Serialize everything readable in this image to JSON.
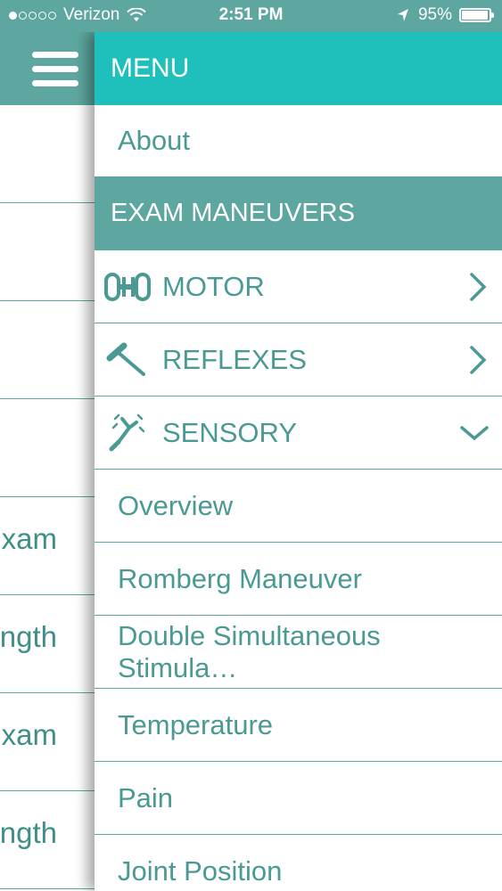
{
  "status_bar": {
    "carrier": "Verizon",
    "time": "2:51 PM",
    "battery": "95%",
    "signal_dots_filled": 1,
    "signal_dots_total": 5
  },
  "left_panel": {
    "rows": [
      "",
      "",
      "",
      "",
      "xam",
      "ngth",
      "xam",
      "ngth"
    ]
  },
  "menu": {
    "header": "MENU",
    "about": "About",
    "section": "EXAM MANEUVERS",
    "categories": [
      {
        "label": "MOTOR",
        "icon": "dumbbell-icon",
        "state": "collapsed"
      },
      {
        "label": "REFLEXES",
        "icon": "reflex-hammer-icon",
        "state": "collapsed"
      },
      {
        "label": "SENSORY",
        "icon": "tuning-fork-icon",
        "state": "expanded"
      }
    ],
    "sensory_items": [
      "Overview",
      "Romberg Maneuver",
      "Double Simultaneous Stimula…",
      "Temperature",
      "Pain",
      "Joint Position"
    ]
  },
  "colors": {
    "menu_header": "#1fbfbb",
    "section_header": "#5ea7a0",
    "text": "#4a9a93"
  }
}
